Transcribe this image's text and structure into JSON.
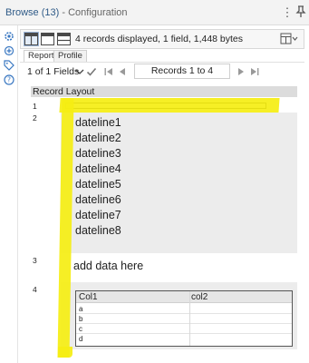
{
  "window": {
    "tool_name": "Browse (13)",
    "separator": " - ",
    "panel_name": "Configuration",
    "menu_icon": "more-vertical-icon",
    "pin_icon": "pin-icon"
  },
  "sidebar": {
    "icons": [
      "gear-icon",
      "connections-icon",
      "tag-icon",
      "help-icon"
    ]
  },
  "toolbar": {
    "layouts": [
      "layout-split-vertical-icon",
      "layout-single-icon",
      "layout-split-horizontal-icon"
    ],
    "info": "4 records displayed, 1 field, 1,448 bytes",
    "export_icon": "export-dropdown-icon"
  },
  "tabs": [
    {
      "label": "Report",
      "active": true
    },
    {
      "label": "Profile",
      "active": false
    }
  ],
  "navigation": {
    "fields_label": "1 of 1 Fields",
    "records_label": "Records 1 to 4"
  },
  "grid": {
    "header": "Record Layout",
    "row_numbers": [
      "1",
      "2",
      "3",
      "4"
    ],
    "datelines": [
      "dateline1",
      "dateline2",
      "dateline3",
      "dateline4",
      "dateline5",
      "dateline6",
      "dateline7",
      "dateline8"
    ],
    "row3_text": "add data here",
    "subtable": {
      "columns": [
        "Col1",
        "col2"
      ],
      "rows": [
        "a",
        "b",
        "c",
        "d"
      ]
    }
  },
  "colors": {
    "highlight": "#f5ee12",
    "title_accent": "#2e5a87"
  }
}
